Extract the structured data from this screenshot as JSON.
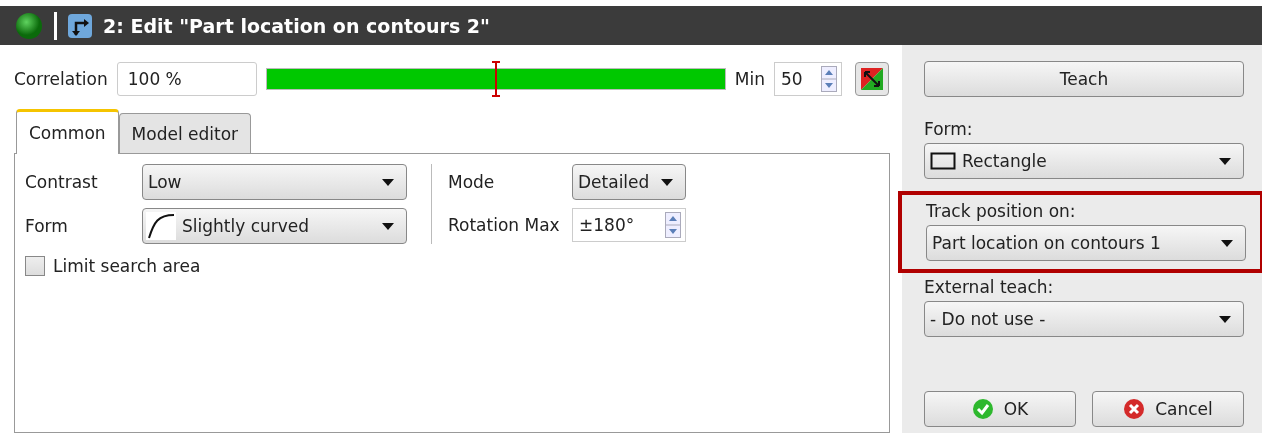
{
  "window": {
    "title": "2: Edit \"Part location on contours 2\""
  },
  "correlation": {
    "label": "Correlation",
    "value": "100 %",
    "bar": {
      "level": 1
    },
    "marker": {
      "level": 0.5
    },
    "min_label": "Min",
    "min_value": "50"
  },
  "tabs": [
    {
      "label": "Common",
      "selected": true
    },
    {
      "label": "Model editor",
      "selected": false
    }
  ],
  "common": {
    "contrast": {
      "label": "Contrast",
      "value": "Low"
    },
    "form": {
      "label": "Form",
      "value": "Slightly curved"
    },
    "mode": {
      "label": "Mode",
      "value": "Detailed"
    },
    "rotation_max": {
      "label": "Rotation Max",
      "value": "±180°"
    },
    "limit_search_area": {
      "label": "Limit search area",
      "checked": false
    }
  },
  "side": {
    "teach_button": "Teach",
    "form": {
      "label": "Form:",
      "value": "Rectangle"
    },
    "track_position": {
      "label": "Track position on:",
      "value": "Part location on contours 1",
      "highlighted": true
    },
    "external_teach": {
      "label": "External teach:",
      "value": "- Do not use -"
    },
    "ok_button": "OK",
    "cancel_button": "Cancel"
  }
}
